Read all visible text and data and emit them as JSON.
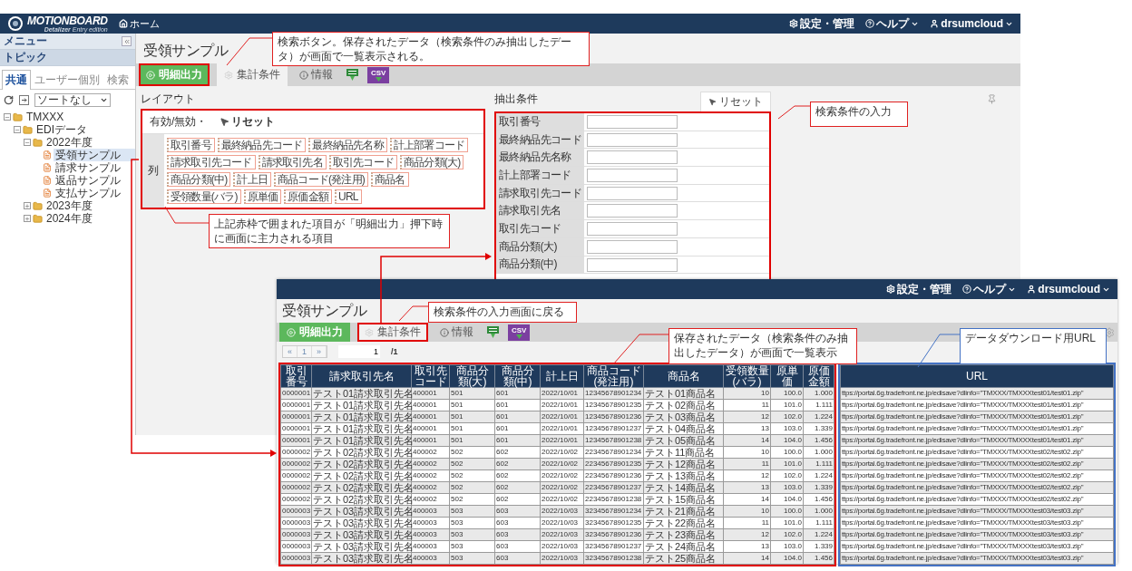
{
  "app": {
    "logo": "MOTIONBOARD",
    "edition": "**Detalizer** Entry edition",
    "home": "ホーム"
  },
  "header_menu": [
    {
      "kind": "settings",
      "label": "設定・管理",
      "dropdown": false
    },
    {
      "kind": "help",
      "label": "ヘルプ",
      "dropdown": true
    },
    {
      "kind": "user",
      "label": "drsumcloud",
      "dropdown": true
    }
  ],
  "sidebar": {
    "menu": "メニュー",
    "topic": "トピック",
    "tabs": [
      {
        "label": "共通",
        "selected": true
      },
      {
        "label": "ユーザー個別",
        "selected": false
      },
      {
        "label": "検索",
        "selected": false
      }
    ],
    "sort": "ソートなし",
    "tree": [
      {
        "label": "TMXXX",
        "kind": "folder",
        "expanded": true,
        "selected": false,
        "children": [
          {
            "label": "EDIデータ",
            "kind": "folder",
            "expanded": true,
            "selected": false,
            "children": [
              {
                "label": "2022年度",
                "kind": "folder",
                "expanded": true,
                "selected": false,
                "children": [
                  {
                    "label": "受領サンプル",
                    "kind": "file",
                    "selected": true
                  },
                  {
                    "label": "請求サンプル",
                    "kind": "file",
                    "selected": false
                  },
                  {
                    "label": "返品サンプル",
                    "kind": "file",
                    "selected": false
                  },
                  {
                    "label": "支払サンプル",
                    "kind": "file",
                    "selected": false
                  }
                ]
              },
              {
                "label": "2023年度",
                "kind": "folder",
                "expanded": false,
                "selected": false
              },
              {
                "label": "2024年度",
                "kind": "folder",
                "expanded": false,
                "selected": false
              }
            ]
          }
        ]
      }
    ]
  },
  "page": {
    "title": "受領サンプル",
    "toolbar": [
      {
        "kind": "run",
        "label": "明細出力",
        "highlighted": true
      },
      {
        "kind": "conditions",
        "label": "集計条件",
        "highlighted": false
      },
      {
        "kind": "info",
        "label": "情報",
        "highlighted": false
      },
      {
        "kind": "excel",
        "highlighted": false
      },
      {
        "kind": "csv",
        "label": "CSV",
        "highlighted": false
      }
    ],
    "layout": {
      "title": "レイアウト",
      "toggle": "有効/無効・",
      "reset": "リセット",
      "row_label": "列",
      "highlighted": true,
      "fields": [
        "取引番号",
        "最終納品先コード",
        "最終納品先名称",
        "計上部署コード",
        "請求取引先コード",
        "請求取引先名",
        "取引先コード",
        "商品分類(大)",
        "商品分類(中)",
        "計上日",
        "商品コード(発注用)",
        "商品名",
        "受領数量(バラ)",
        "原単価",
        "原価金額",
        "URL"
      ]
    },
    "conditions": {
      "title": "抽出条件",
      "reset": "リセット",
      "highlighted": true,
      "fields": [
        "取引番号",
        "最終納品先コード",
        "最終納品先名称",
        "計上部署コード",
        "請求取引先コード",
        "請求取引先名",
        "取引先コード",
        "商品分類(大)",
        "商品分類(中)"
      ]
    }
  },
  "results_window": {
    "header_menu": [
      {
        "kind": "settings",
        "label": "設定・管理",
        "dropdown": false
      },
      {
        "kind": "help",
        "label": "ヘルプ",
        "dropdown": true
      },
      {
        "kind": "user",
        "label": "drsumcloud",
        "dropdown": true
      }
    ],
    "title": "受領サンプル",
    "toolbar": [
      {
        "kind": "run",
        "label": "明細出力",
        "highlighted": false
      },
      {
        "kind": "conditions",
        "label": "集計条件",
        "highlighted": true
      },
      {
        "kind": "info",
        "label": "情報",
        "highlighted": false
      },
      {
        "kind": "excel",
        "highlighted": false
      },
      {
        "kind": "csv",
        "label": "CSV",
        "highlighted": false
      }
    ],
    "pager": {
      "prev": "«",
      "page": "1",
      "next": "»",
      "page_input": "1",
      "total": "/1"
    },
    "column_groups": [
      {
        "color": "#e00000",
        "columns": [
          {
            "label": "取引番号",
            "kind": "code"
          },
          {
            "label": "請求取引先名",
            "kind": "text"
          },
          {
            "label": "取引先コード",
            "kind": "code"
          },
          {
            "label": "商品分類(大)",
            "kind": "code"
          },
          {
            "label": "商品分類(中)",
            "kind": "code"
          },
          {
            "label": "計上日",
            "kind": "code"
          },
          {
            "label": "商品コード(発注用)",
            "kind": "code"
          },
          {
            "label": "商品名",
            "kind": "text"
          },
          {
            "label": "受領数量(バラ)",
            "kind": "number"
          },
          {
            "label": "原単価",
            "kind": "number"
          },
          {
            "label": "原価金額",
            "kind": "number"
          }
        ]
      },
      {
        "color": "#4472c4",
        "columns": [
          {
            "label": "URL",
            "kind": "url"
          }
        ]
      }
    ],
    "rows": [
      [
        "0000001",
        "テスト01請求取引先名",
        "400001",
        "501",
        "601",
        "2022/10/01",
        "12345678901234",
        "テスト01商品名",
        "10",
        "100.0",
        "1.000",
        "ttps://portal.6g.tradefront.ne.jp/edisave?dlinfo=\"TMXXX/TMXXXtest01/test01.zip\""
      ],
      [
        "0000001",
        "テスト01請求取引先名",
        "400001",
        "501",
        "601",
        "2022/10/01",
        "12345678901235",
        "テスト02商品名",
        "11",
        "101.0",
        "1.111",
        "ttps://portal.6g.tradefront.ne.jp/edisave?dlinfo=\"TMXXX/TMXXXtest01/test01.zip\""
      ],
      [
        "0000001",
        "テスト01請求取引先名",
        "400001",
        "501",
        "601",
        "2022/10/01",
        "12345678901236",
        "テスト03商品名",
        "12",
        "102.0",
        "1.224",
        "ttps://portal.6g.tradefront.ne.jp/edisave?dlinfo=\"TMXXX/TMXXXtest01/test01.zip\""
      ],
      [
        "0000001",
        "テスト01請求取引先名",
        "400001",
        "501",
        "601",
        "2022/10/01",
        "12345678901237",
        "テスト04商品名",
        "13",
        "103.0",
        "1.339",
        "ttps://portal.6g.tradefront.ne.jp/edisave?dlinfo=\"TMXXX/TMXXXtest01/test01.zip\""
      ],
      [
        "0000001",
        "テスト01請求取引先名",
        "400001",
        "501",
        "601",
        "2022/10/01",
        "12345678901238",
        "テスト05商品名",
        "14",
        "104.0",
        "1.456",
        "ttps://portal.6g.tradefront.ne.jp/edisave?dlinfo=\"TMXXX/TMXXXtest01/test01.zip\""
      ],
      [
        "0000002",
        "テスト02請求取引先名",
        "400002",
        "502",
        "602",
        "2022/10/02",
        "22345678901234",
        "テスト11商品名",
        "10",
        "100.0",
        "1.000",
        "ttps://portal.6g.tradefront.ne.jp/edisave?dlinfo=\"TMXXX/TMXXXtest02/test02.zip\""
      ],
      [
        "0000002",
        "テスト02請求取引先名",
        "400002",
        "502",
        "602",
        "2022/10/02",
        "22345678901235",
        "テスト12商品名",
        "11",
        "101.0",
        "1.111",
        "ttps://portal.6g.tradefront.ne.jp/edisave?dlinfo=\"TMXXX/TMXXXtest02/test02.zip\""
      ],
      [
        "0000002",
        "テスト02請求取引先名",
        "400002",
        "502",
        "602",
        "2022/10/02",
        "22345678901236",
        "テスト13商品名",
        "12",
        "102.0",
        "1.224",
        "ttps://portal.6g.tradefront.ne.jp/edisave?dlinfo=\"TMXXX/TMXXXtest02/test02.zip\""
      ],
      [
        "0000002",
        "テスト02請求取引先名",
        "400002",
        "502",
        "602",
        "2022/10/02",
        "22345678901237",
        "テスト14商品名",
        "13",
        "103.0",
        "1.339",
        "ttps://portal.6g.tradefront.ne.jp/edisave?dlinfo=\"TMXXX/TMXXXtest02/test02.zip\""
      ],
      [
        "0000002",
        "テスト02請求取引先名",
        "400002",
        "502",
        "602",
        "2022/10/02",
        "22345678901238",
        "テスト15商品名",
        "14",
        "104.0",
        "1.456",
        "ttps://portal.6g.tradefront.ne.jp/edisave?dlinfo=\"TMXXX/TMXXXtest02/test02.zip\""
      ],
      [
        "0000003",
        "テスト03請求取引先名",
        "400003",
        "503",
        "603",
        "2022/10/03",
        "32345678901234",
        "テスト21商品名",
        "10",
        "100.0",
        "1.000",
        "ttps://portal.6g.tradefront.ne.jp/edisave?dlinfo=\"TMXXX/TMXXXtest03/test03.zip\""
      ],
      [
        "0000003",
        "テスト03請求取引先名",
        "400003",
        "503",
        "603",
        "2022/10/03",
        "32345678901235",
        "テスト22商品名",
        "11",
        "101.0",
        "1.111",
        "ttps://portal.6g.tradefront.ne.jp/edisave?dlinfo=\"TMXXX/TMXXXtest03/test03.zip\""
      ],
      [
        "0000003",
        "テスト03請求取引先名",
        "400003",
        "503",
        "603",
        "2022/10/03",
        "32345678901236",
        "テスト23商品名",
        "12",
        "102.0",
        "1.224",
        "ttps://portal.6g.tradefront.ne.jp/edisave?dlinfo=\"TMXXX/TMXXXtest03/test03.zip\""
      ],
      [
        "0000003",
        "テスト03請求取引先名",
        "400003",
        "503",
        "603",
        "2022/10/03",
        "32345678901237",
        "テスト24商品名",
        "13",
        "103.0",
        "1.339",
        "ttps://portal.6g.tradefront.ne.jp/edisave?dlinfo=\"TMXXX/TMXXXtest03/test03.zip\""
      ],
      [
        "0000003",
        "テスト03請求取引先名",
        "400003",
        "503",
        "603",
        "2022/10/03",
        "32345678901238",
        "テスト25商品名",
        "14",
        "104.0",
        "1.456",
        "ttps://portal.6g.tradefront.ne.jp/edisave?dlinfo=\"TMXXX/TMXXXtest03/test03.zip\""
      ]
    ]
  },
  "callouts": [
    {
      "text": "検索ボタン。保存されたデータ（検索条件のみ抽出したデータ）が画面で一覧表示される。",
      "color": "#e02020"
    },
    {
      "text": "検索条件の入力",
      "color": "#e02020"
    },
    {
      "text": "上記赤枠で囲まれた項目が「明細出力」押下時に画面に主力される項目",
      "color": "#e02020"
    },
    {
      "text": "検索条件の入力画面に戻る",
      "color": "#e02020"
    },
    {
      "text": "保存されたデータ（検索条件のみ抽出したデータ）が画面で一覧表示",
      "color": "#e02020"
    },
    {
      "text": "データダウンロード用URL",
      "color": "#4472c4"
    }
  ]
}
